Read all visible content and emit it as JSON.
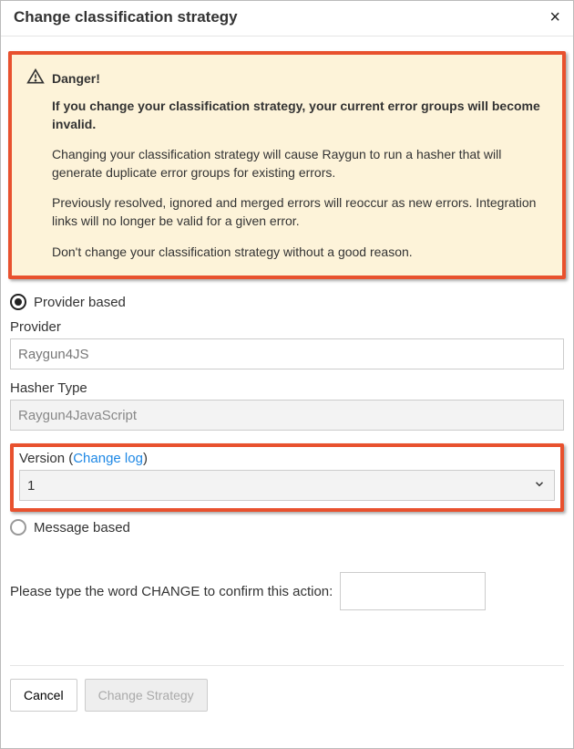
{
  "dialog": {
    "title": "Change classification strategy"
  },
  "danger": {
    "title": "Danger!",
    "strong": "If you change your classification strategy, your current error groups will become invalid.",
    "p1": "Changing your classification strategy will cause Raygun to run a hasher that will generate duplicate error groups for existing errors.",
    "p2": "Previously resolved, ignored and merged errors will reoccur as new errors. Integration links will no longer be valid for a given error.",
    "p3": "Don't change your classification strategy without a good reason."
  },
  "form": {
    "radio_provider": "Provider based",
    "radio_message": "Message based",
    "provider_label": "Provider",
    "provider_value": "Raygun4JS",
    "hasher_label": "Hasher Type",
    "hasher_value": "Raygun4JavaScript",
    "version_label_prefix": "Version (",
    "version_changelog": "Change log",
    "version_label_suffix": ")",
    "version_value": "1",
    "confirm_label": "Please type the word CHANGE to confirm this action:"
  },
  "footer": {
    "cancel": "Cancel",
    "submit": "Change Strategy"
  }
}
